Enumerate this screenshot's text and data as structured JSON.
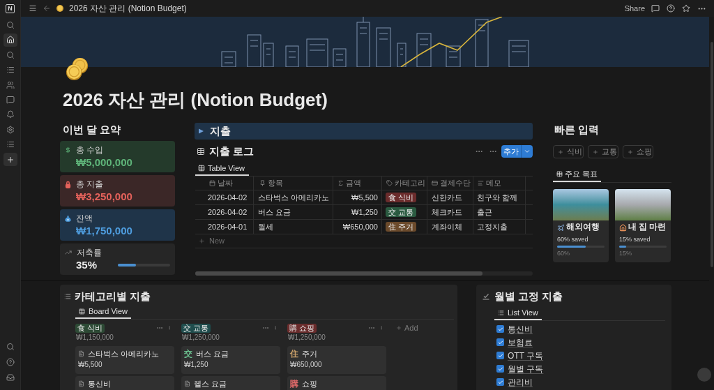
{
  "topbar": {
    "logo": "N",
    "title": "2026 자산 관리 (Notion Budget)",
    "share": "Share"
  },
  "sidebar": {
    "items": [
      {
        "kind": "search",
        "selected": false
      },
      {
        "kind": "home",
        "selected": true
      },
      {
        "kind": "search",
        "selected": false
      },
      {
        "kind": "list",
        "selected": false
      },
      {
        "kind": "people",
        "selected": false
      },
      {
        "kind": "chat",
        "selected": false
      },
      {
        "kind": "bell",
        "selected": false
      },
      {
        "kind": "settings",
        "selected": false
      },
      {
        "kind": "list",
        "selected": false
      },
      {
        "kind": "add",
        "selected": true
      }
    ],
    "bottom_items": [
      {
        "kind": "search",
        "selected": false
      },
      {
        "kind": "help",
        "selected": false
      },
      {
        "kind": "inbox",
        "selected": false
      }
    ]
  },
  "page": {
    "title": "2026 자산 관리 (Notion Budget)"
  },
  "summary": {
    "heading": "이번 달 요약",
    "cards": [
      {
        "kind": "income",
        "label": "총 수입",
        "value": "₩5,000,000"
      },
      {
        "kind": "expense",
        "label": "총 지출",
        "value": "₩3,250,000"
      },
      {
        "kind": "balance",
        "label": "잔액",
        "value": "₩1,750,000"
      },
      {
        "kind": "rate",
        "label": "저축률",
        "value": "35%",
        "level": 0.35
      }
    ]
  },
  "expense_toggle": {
    "title": "지출",
    "expanded": false
  },
  "expense_log": {
    "title": "지출 로그",
    "add_button": "추가",
    "tabs": [
      {
        "label": "Table View",
        "selected": true
      }
    ],
    "columns": [
      {
        "kind": "date",
        "label": "날짜"
      },
      {
        "kind": "title",
        "label": "항목"
      },
      {
        "kind": "number",
        "label": "금액"
      },
      {
        "kind": "tag",
        "label": "카테고리"
      },
      {
        "kind": "payment",
        "label": "결제수단"
      },
      {
        "kind": "text",
        "label": "메모"
      }
    ],
    "rows": [
      {
        "date": "2026-04-02",
        "item": "스타벅스 아메리카노",
        "amount": "₩5,500",
        "category": {
          "label": "食 식비",
          "color": "#6b2c2c"
        },
        "payment": "신한카드",
        "memo": "친구와 함께"
      },
      {
        "date": "2026-04-02",
        "item": "버스 요금",
        "amount": "₩1,250",
        "category": {
          "label": "交 교통",
          "color": "#2a5a40"
        },
        "payment": "체크카드",
        "memo": "출근"
      },
      {
        "date": "2026-04-01",
        "item": "월세",
        "amount": "₩650,000",
        "category": {
          "label": "住 주거",
          "color": "#6b4a2b"
        },
        "payment": "계좌이체",
        "memo": "고정지출"
      }
    ],
    "new_row": "New"
  },
  "quick_input": {
    "heading": "빠른 입력",
    "buttons": [
      "식비",
      "교통",
      "쇼핑"
    ],
    "tabs": [
      {
        "label": "주요 목표",
        "selected": true
      }
    ],
    "goals": [
      {
        "kind": "travel",
        "title": "해외여행",
        "caption": "60% saved",
        "level": 0.6,
        "reading": "60%"
      },
      {
        "kind": "home",
        "title": "내 집 마련",
        "caption": "15% saved",
        "level": 0.15,
        "reading": "15%"
      }
    ]
  },
  "category_board": {
    "title": "카테고리별 지출",
    "tabs": [
      {
        "label": "Board View",
        "selected": true
      }
    ],
    "groups": [
      {
        "tag": {
          "label": "食 식비",
          "color": "#2d4a35"
        },
        "total": "₩1,150,000",
        "cards": [
          {
            "kind": "page",
            "title": "스타벅스 아메리카노",
            "amount": "₩5,500"
          },
          {
            "kind": "page",
            "title": "통신비"
          }
        ]
      },
      {
        "tag": {
          "label": "交 교통",
          "color": "#1f4d4d"
        },
        "total": "₩1,250,000",
        "cards": [
          {
            "kind": "glyph",
            "glyph": "交",
            "color": "#6cc08f",
            "title": "버스 요금",
            "amount": "₩1,250"
          },
          {
            "kind": "page",
            "title": "헬스 요금"
          }
        ]
      },
      {
        "tag": {
          "label": "購 쇼핑",
          "color": "#6a2c2c"
        },
        "total": "₩1,250,000",
        "cards": [
          {
            "kind": "glyph",
            "glyph": "住",
            "color": "#caa06a",
            "title": "주거",
            "amount": "₩650,000"
          },
          {
            "kind": "glyph",
            "glyph": "購",
            "color": "#e06a6a",
            "title": "쇼핑"
          }
        ]
      }
    ],
    "add_group": "Add"
  },
  "fixed_expenses": {
    "title": "월별 고정 지출",
    "tabs": [
      {
        "label": "List View",
        "selected": true
      }
    ],
    "items": [
      {
        "label": "통신비",
        "checked": true
      },
      {
        "label": "보험료",
        "checked": true
      },
      {
        "label": "OTT 구독",
        "checked": true
      },
      {
        "label": "월별 구독",
        "checked": true
      },
      {
        "label": "관리비",
        "checked": true
      }
    ]
  }
}
